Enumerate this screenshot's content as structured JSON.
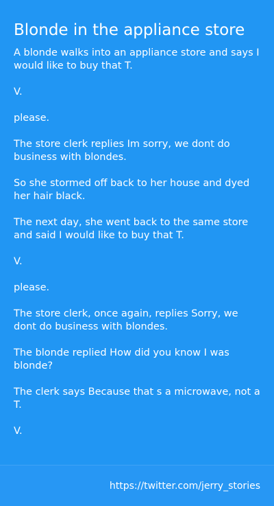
{
  "story": {
    "title": "Blonde in the appliance store",
    "paragraphs": [
      "A blonde walks into an appliance store and says I would like to buy that T.",
      "V.",
      "please.",
      "The store clerk replies Im sorry, we dont do business with blondes.",
      "So she stormed off back to her house and dyed her hair black.",
      "The next day, she went back to the same store and said I would like to buy that T.",
      "V.",
      "please.",
      "The store clerk, once again, replies Sorry, we dont do business with blondes.",
      "The blonde replied How did you know I was blonde?",
      "The clerk says Because that s a microwave, not a T.",
      "V."
    ]
  },
  "footer": {
    "link_text": "https://twitter.com/jerry_stories"
  },
  "colors": {
    "background": "#2196F3",
    "text": "#FFFFFF"
  }
}
